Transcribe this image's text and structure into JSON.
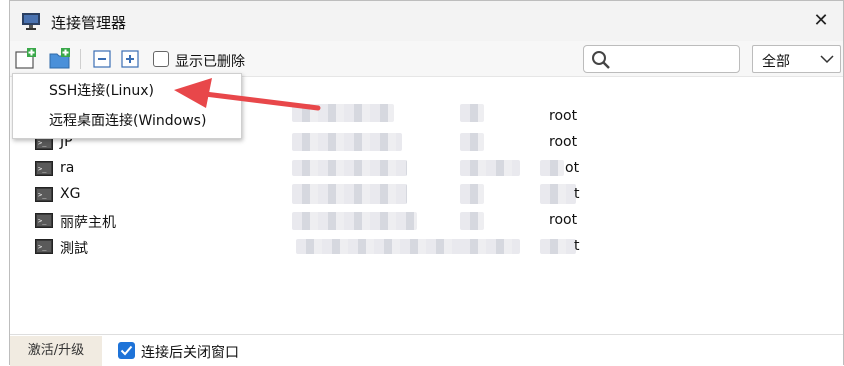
{
  "window": {
    "title": "连接管理器",
    "close_glyph": "✕"
  },
  "toolbar": {
    "show_deleted_label": "显示已删除",
    "search": {
      "placeholder": "",
      "value": ""
    },
    "filter": {
      "selected": "全部"
    }
  },
  "dropdown_menu": {
    "items": [
      {
        "label": "SSH连接(Linux)"
      },
      {
        "label": "远程桌面连接(Windows)"
      }
    ]
  },
  "connections": [
    {
      "name": "",
      "user": "root"
    },
    {
      "name": "JP",
      "user": "root"
    },
    {
      "name": "ra",
      "user": "ot"
    },
    {
      "name": "XG",
      "user": "t"
    },
    {
      "name": "丽萨主机",
      "user": "root"
    },
    {
      "name": "測試",
      "user": "t"
    }
  ],
  "statusbar": {
    "activate_label": "激活/升级",
    "close_after_connect_label": "连接后关闭窗口",
    "close_after_connect_checked": true
  },
  "colors": {
    "accent": "#1e73d8",
    "arrow": "#e8474a"
  }
}
